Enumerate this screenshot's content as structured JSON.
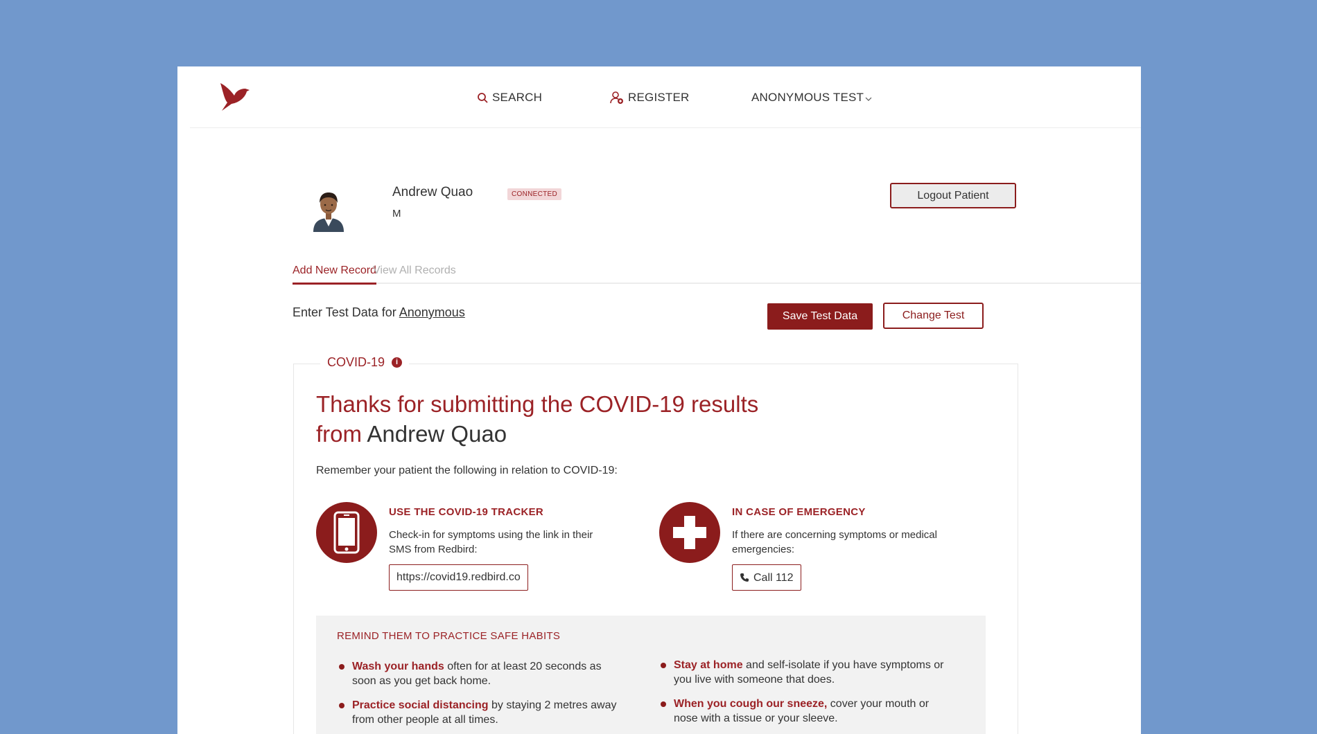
{
  "nav": {
    "search_label": "SEARCH",
    "register_label": "REGISTER",
    "anonymous_test_label": "ANONYMOUS TEST"
  },
  "patient": {
    "name": "Andrew Quao",
    "sex": "M",
    "status": "CONNECTED",
    "logout_label": "Logout Patient"
  },
  "tabs": [
    {
      "label": "Add New Record",
      "active": true
    },
    {
      "label": "View All Records",
      "active": false
    }
  ],
  "entry": {
    "prefix": "Enter Test Data for",
    "target": "Anonymous",
    "save_label": "Save Test Data",
    "change_label": "Change Test"
  },
  "section": {
    "legend": "COVID-19",
    "info_icon": "i",
    "thanks_line1": "Thanks for submitting the COVID-19 results",
    "thanks_from": "from",
    "thanks_name": "Andrew Quao",
    "remember": "Remember your patient the following in relation to COVID-19:"
  },
  "tracker": {
    "icon": "phone-icon",
    "title": "USE THE COVID-19 TRACKER",
    "text": "Check-in for symptoms using the link in their SMS from Redbird:",
    "link": "https://covid19.redbird.co"
  },
  "emergency": {
    "icon": "cross-icon",
    "title": "IN CASE OF EMERGENCY",
    "text": "If there are concerning symptoms or medical emergencies:",
    "call_label": "Call 112"
  },
  "habits": {
    "title": "REMIND THEM TO PRACTICE SAFE HABITS",
    "items": [
      {
        "bold": "Wash your hands",
        "rest": " often for at least 20 seconds as soon as you get back home."
      },
      {
        "bold": "Practice social distancing",
        "rest": " by staying 2 metres away from other people at all times."
      },
      {
        "bold": "Stay at home",
        "rest": " and self-isolate if you have symptoms or you live with someone that does."
      },
      {
        "bold": "When you cough our sneeze,",
        "rest": " cover your mouth or nose with a tissue or your sleeve."
      }
    ]
  },
  "colors": {
    "background": "#7198cc",
    "accent": "#8b1c1c",
    "accent_text": "#9b2226"
  }
}
